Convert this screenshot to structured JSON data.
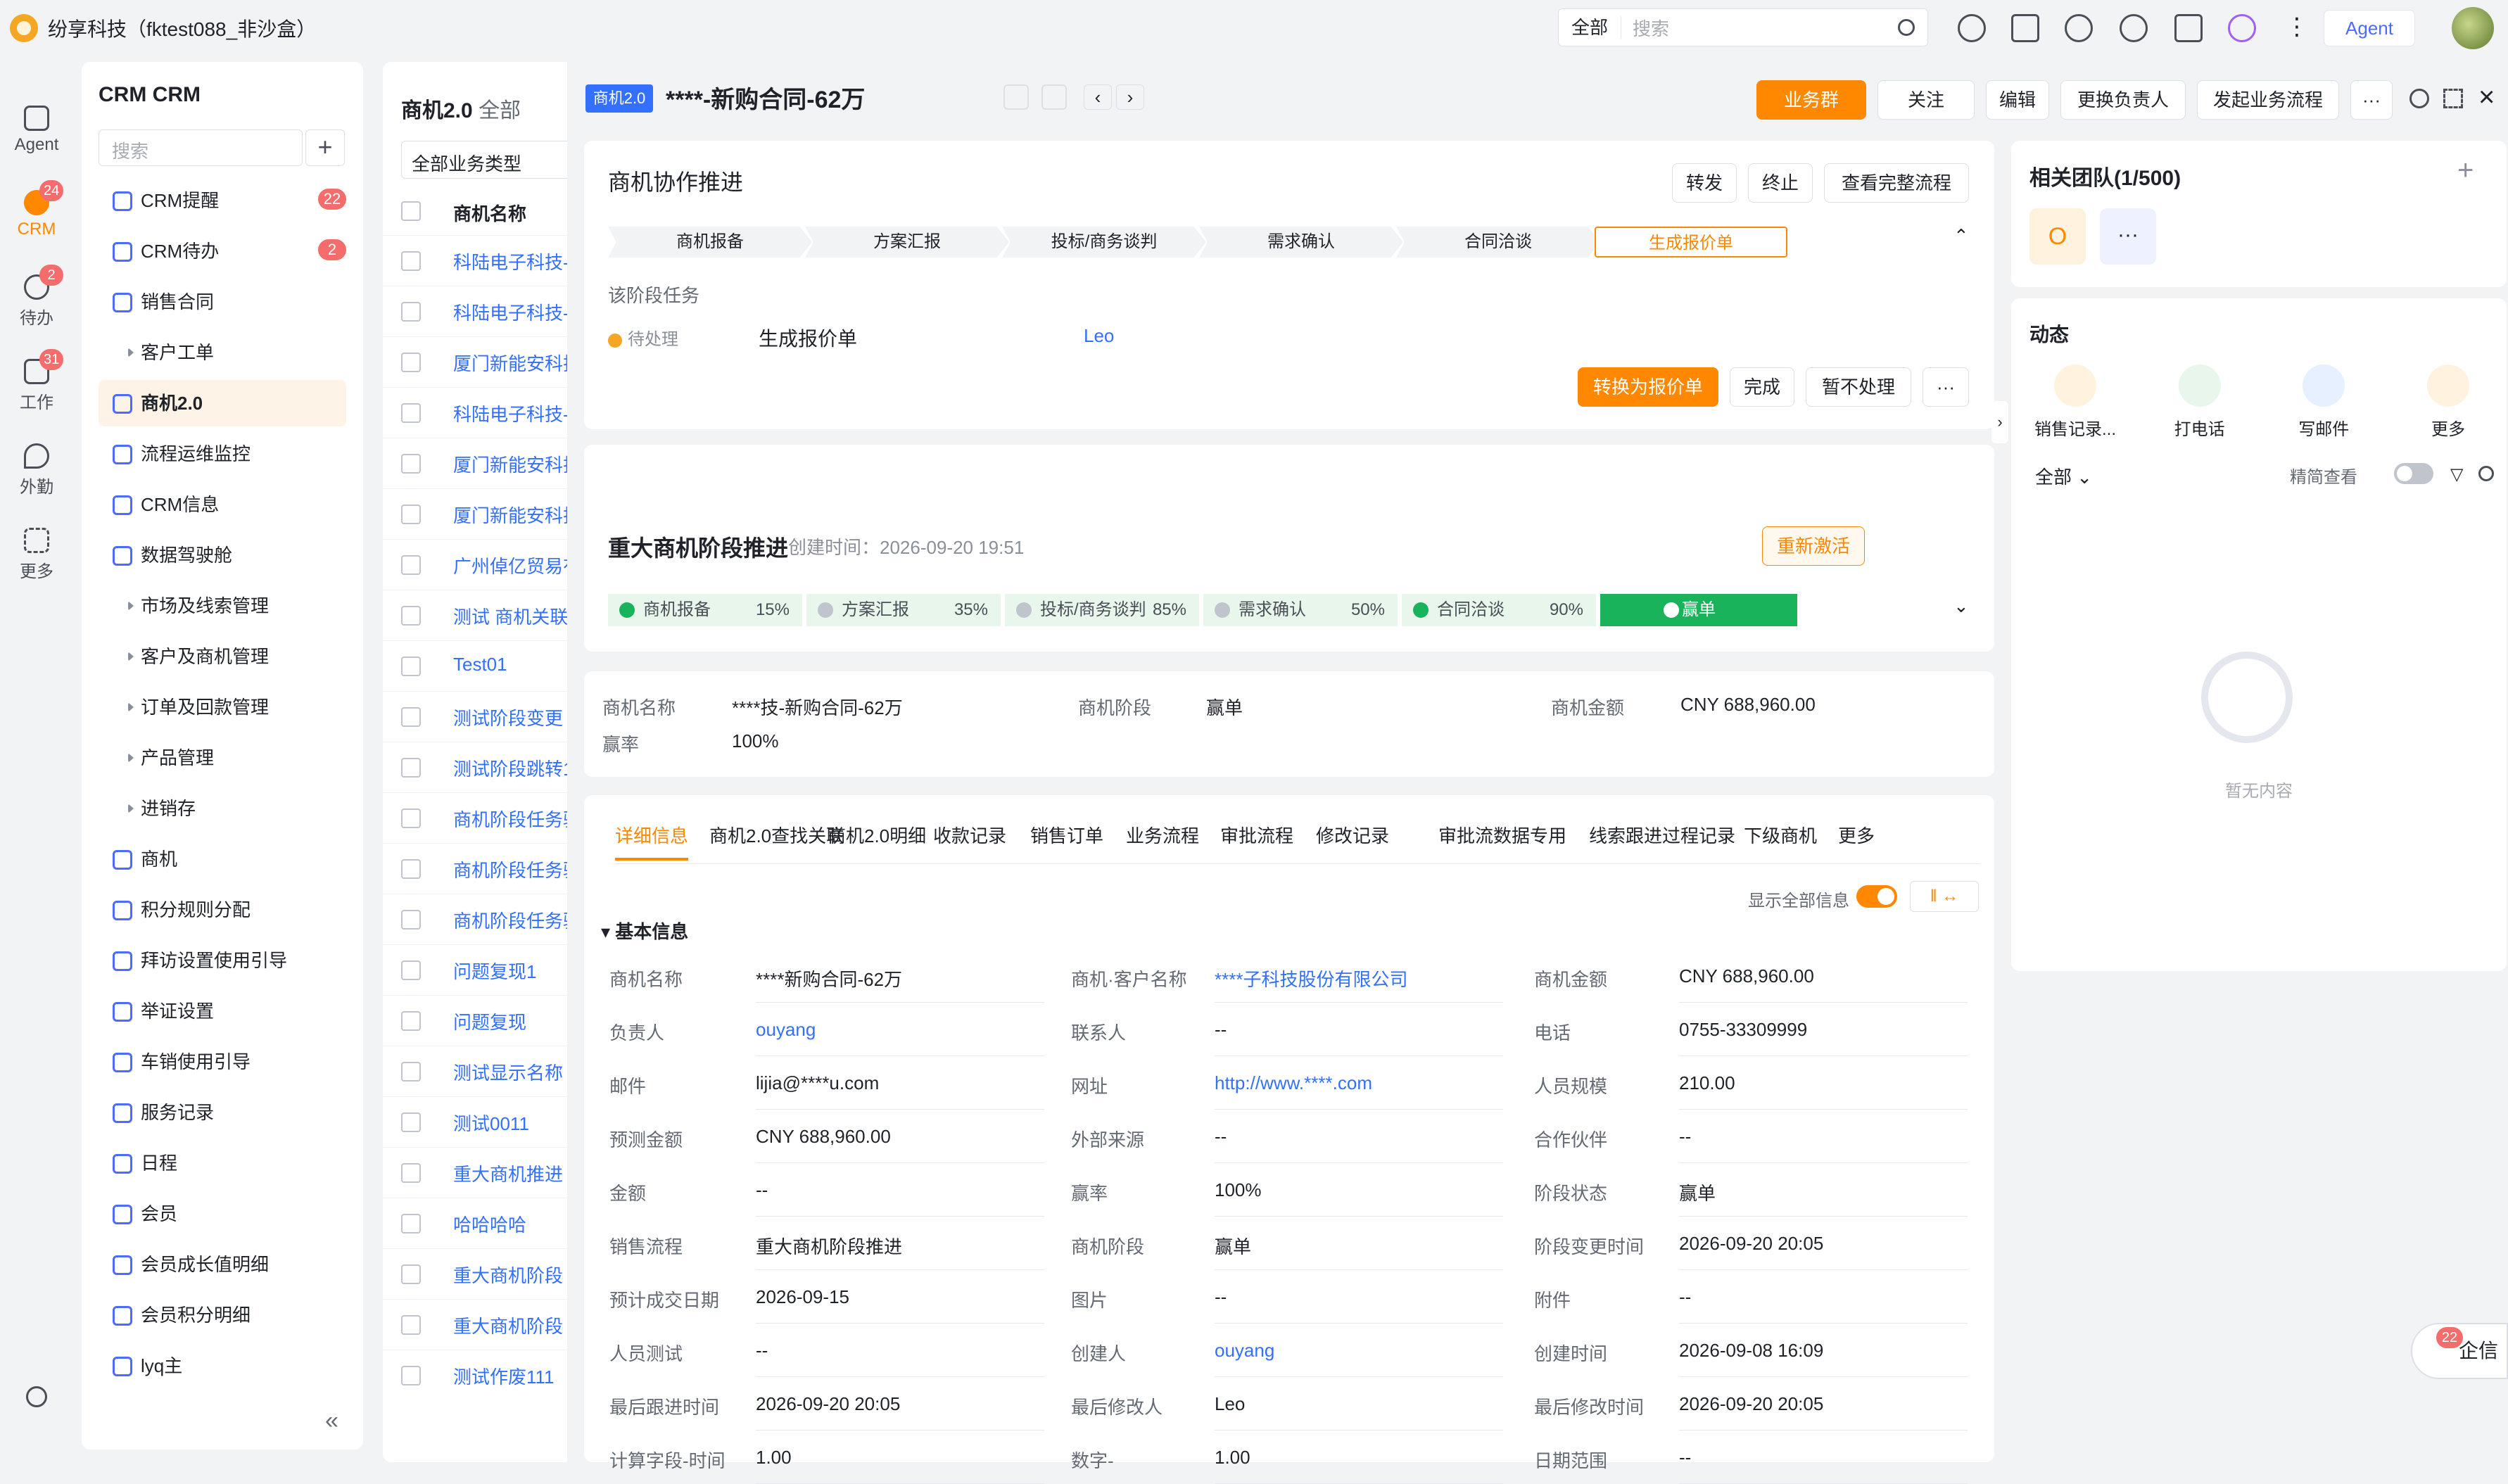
{
  "top": {
    "company": "纷享科技（fktest088_非沙盒）",
    "search_scope": "全部",
    "search_placeholder": "搜索",
    "agent": "Agent"
  },
  "leftbar": [
    {
      "label": "Agent"
    },
    {
      "label": "CRM",
      "badge": "24"
    },
    {
      "label": "待办",
      "badge": "2"
    },
    {
      "label": "工作",
      "badge": "31"
    },
    {
      "label": "外勤"
    },
    {
      "label": "更多"
    }
  ],
  "nav": {
    "title": "CRM CRM",
    "search_placeholder": "搜索",
    "items": [
      {
        "label": "CRM提醒",
        "badge": "22"
      },
      {
        "label": "CRM待办",
        "badge": "2"
      },
      {
        "label": "销售合同"
      },
      {
        "label": "客户工单",
        "arrow": true
      },
      {
        "label": "商机2.0",
        "active": true
      },
      {
        "label": "流程运维监控"
      },
      {
        "label": "CRM信息"
      },
      {
        "label": "数据驾驶舱"
      },
      {
        "label": "市场及线索管理",
        "arrow": true
      },
      {
        "label": "客户及商机管理",
        "arrow": true
      },
      {
        "label": "订单及回款管理",
        "arrow": true
      },
      {
        "label": "产品管理",
        "arrow": true
      },
      {
        "label": "进销存",
        "arrow": true
      },
      {
        "label": "商机"
      },
      {
        "label": "积分规则分配"
      },
      {
        "label": "拜访设置使用引导"
      },
      {
        "label": "举证设置"
      },
      {
        "label": "车销使用引导"
      },
      {
        "label": "服务记录"
      },
      {
        "label": "日程"
      },
      {
        "label": "会员"
      },
      {
        "label": "会员成长值明细"
      },
      {
        "label": "会员积分明细"
      },
      {
        "label": "lyq主"
      }
    ]
  },
  "list": {
    "title": "商机2.0",
    "scope": "全部",
    "filter": "全部业务类型",
    "col": "商机名称",
    "rows": [
      "科陆电子科技-",
      "科陆电子科技-",
      "厦门新能安科技",
      "科陆电子科技-",
      "厦门新能安科技",
      "厦门新能安科技",
      "广州倬亿贸易有",
      "测试 商机关联",
      "Test01",
      "测试阶段变更",
      "测试阶段跳转1",
      "商机阶段任务验",
      "商机阶段任务验",
      "商机阶段任务验",
      "问题复现1",
      "问题复现",
      "测试显示名称",
      "测试0011",
      "重大商机推进",
      "哈哈哈哈",
      "重大商机阶段",
      "重大商机阶段",
      "测试作废111"
    ]
  },
  "header": {
    "tag": "商机2.0",
    "title": "****-新购合同-62万",
    "buttons": [
      "业务群",
      "关注",
      "编辑",
      "更换负责人",
      "发起业务流程"
    ]
  },
  "collab": {
    "title": "商机协作推进",
    "buttons": [
      "转发",
      "终止",
      "查看完整流程"
    ],
    "stages": [
      "商机报备",
      "方案汇报",
      "投标/商务谈判",
      "需求确认",
      "合同洽谈",
      "生成报价单"
    ],
    "task_title": "该阶段任务",
    "task_status": "待处理",
    "task_name": "生成报价单",
    "task_owner": "Leo",
    "actions": [
      "转换为报价单",
      "完成",
      "暂不处理"
    ]
  },
  "progress": {
    "title": "重大商机阶段推进",
    "created": "创建时间：2026-09-20 19:51",
    "reactivate": "重新激活",
    "stages": [
      {
        "name": "商机报备",
        "pct": "15%"
      },
      {
        "name": "方案汇报",
        "pct": "35%"
      },
      {
        "name": "投标/商务谈判",
        "pct": "85%"
      },
      {
        "name": "需求确认",
        "pct": "50%"
      },
      {
        "name": "合同洽谈",
        "pct": "90%"
      },
      {
        "name": "赢单",
        "pct": ""
      }
    ]
  },
  "summary": {
    "name_label": "商机名称",
    "name": "****技-新购合同-62万",
    "stage_label": "商机阶段",
    "stage": "赢单",
    "amount_label": "商机金额",
    "amount": "CNY 688,960.00",
    "rate_label": "赢率",
    "rate": "100%"
  },
  "tabs": [
    "详细信息",
    "商机2.0查找关联",
    "商机2.0明细",
    "收款记录",
    "销售订单",
    "业务流程",
    "审批流程",
    "修改记录",
    "审批流数据专用",
    "线索跟进过程记录",
    "下级商机",
    "更多"
  ],
  "detail": {
    "show_all": "显示全部信息",
    "section": "基本信息",
    "rows": [
      [
        [
          "商机名称",
          "****新购合同-62万",
          false
        ],
        [
          "商机·客户名称",
          "****子科技股份有限公司",
          true
        ],
        [
          "商机金额",
          "CNY 688,960.00",
          false
        ]
      ],
      [
        [
          "负责人",
          "ouyang",
          true
        ],
        [
          "联系人",
          "--",
          false
        ],
        [
          "电话",
          "0755-33309999",
          false
        ]
      ],
      [
        [
          "邮件",
          "lijia@****u.com",
          false
        ],
        [
          "网址",
          "http://www.****.com",
          true
        ],
        [
          "人员规模",
          "210.00",
          false
        ]
      ],
      [
        [
          "预测金额",
          "CNY 688,960.00",
          false
        ],
        [
          "外部来源",
          "--",
          false
        ],
        [
          "合作伙伴",
          "--",
          false
        ]
      ],
      [
        [
          "金额",
          "--",
          false
        ],
        [
          "赢率",
          "100%",
          false
        ],
        [
          "阶段状态",
          "赢单",
          false
        ]
      ],
      [
        [
          "销售流程",
          "重大商机阶段推进",
          false
        ],
        [
          "商机阶段",
          "赢单",
          false
        ],
        [
          "阶段变更时间",
          "2026-09-20 20:05",
          false
        ]
      ],
      [
        [
          "预计成交日期",
          "2026-09-15",
          false
        ],
        [
          "图片",
          "--",
          false
        ],
        [
          "附件",
          "--",
          false
        ]
      ],
      [
        [
          "人员测试",
          "--",
          false
        ],
        [
          "创建人",
          "ouyang",
          true
        ],
        [
          "创建时间",
          "2026-09-08 16:09",
          false
        ]
      ],
      [
        [
          "最后跟进时间",
          "2026-09-20 20:05",
          false
        ],
        [
          "最后修改人",
          "Leo",
          false
        ],
        [
          "最后修改时间",
          "2026-09-20 20:05",
          false
        ]
      ],
      [
        [
          "计算字段-时间",
          "1.00",
          false
        ],
        [
          "数字-",
          "1.00",
          false
        ],
        [
          "日期范围",
          "--",
          false
        ]
      ]
    ]
  },
  "team": {
    "title": "相关团队(1/500)",
    "member": "O"
  },
  "activity": {
    "title": "动态",
    "actions": [
      "销售记录...",
      "打电话",
      "写邮件",
      "更多"
    ],
    "filter": "全部",
    "compact": "精简查看",
    "empty": "暂无内容"
  },
  "qixin": {
    "label": "企信",
    "badge": "22"
  }
}
